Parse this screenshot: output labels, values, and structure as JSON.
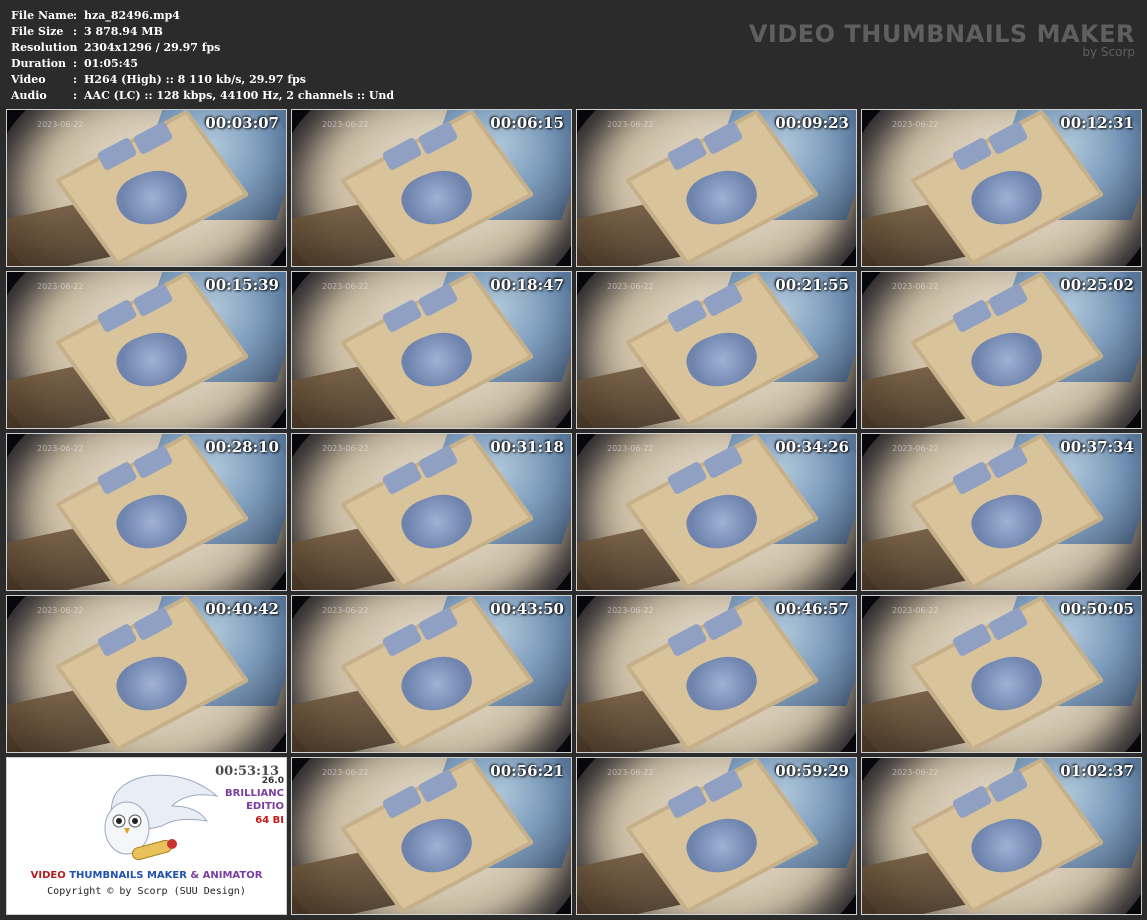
{
  "info": [
    {
      "key": "File Name",
      "sep": ":",
      "value": "hza_82496.mp4"
    },
    {
      "key": "File Size",
      "sep": ":",
      "value": "3 878.94 MB"
    },
    {
      "key": "Resolution",
      "sep": ":",
      "value": "2304x1296 / 29.97 fps"
    },
    {
      "key": "Duration",
      "sep": ":",
      "value": "01:05:45"
    },
    {
      "key": "Video",
      "sep": ":",
      "value": "H264 (High) :: 8 110 kb/s, 29.97 fps"
    },
    {
      "key": "Audio",
      "sep": ":",
      "value": "AAC (LC) :: 128 kbps, 44100 Hz, 2 channels :: Und"
    }
  ],
  "brand": {
    "title": "VIDEO THUMBNAILS MAKER",
    "by": "by Scorp"
  },
  "thumbnails": [
    {
      "time": "00:03:07"
    },
    {
      "time": "00:06:15"
    },
    {
      "time": "00:09:23"
    },
    {
      "time": "00:12:31"
    },
    {
      "time": "00:15:39"
    },
    {
      "time": "00:18:47"
    },
    {
      "time": "00:21:55"
    },
    {
      "time": "00:25:02"
    },
    {
      "time": "00:28:10"
    },
    {
      "time": "00:31:18"
    },
    {
      "time": "00:34:26"
    },
    {
      "time": "00:37:34"
    },
    {
      "time": "00:40:42"
    },
    {
      "time": "00:43:50"
    },
    {
      "time": "00:46:57"
    },
    {
      "time": "00:50:05"
    },
    {
      "time": "00:53:13"
    },
    {
      "time": "00:56:21"
    },
    {
      "time": "00:59:29"
    },
    {
      "time": "01:02:37"
    }
  ],
  "frame_stamp": "2023-06-22",
  "logo": {
    "edition_lines": [
      "26.0",
      "BRILLIANC",
      "EDITIO",
      "64 BI"
    ],
    "name_parts": [
      "VIDEO",
      "THUMBNAILS MAKER",
      "& ANIMATOR"
    ],
    "copyright": "Copyright © by Scorp (SUU Design)"
  },
  "colors": {
    "background": "#2b2b2b",
    "info_text": "#ffffff",
    "brand_text": "#5f5f5f",
    "timestamp": "#ffffff"
  }
}
